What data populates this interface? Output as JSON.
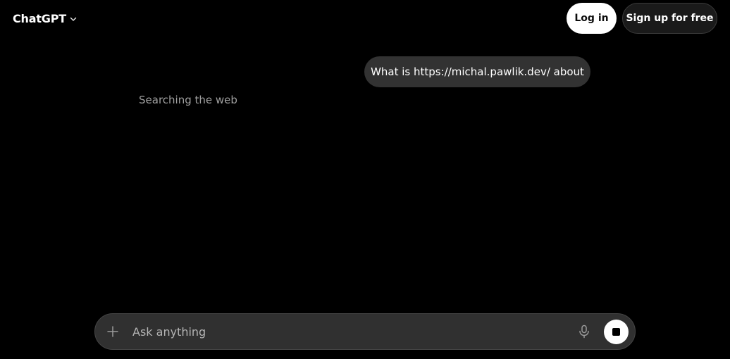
{
  "header": {
    "model_name": "ChatGPT",
    "model_switcher_icon": "chevron-down-icon",
    "login_label": "Log in",
    "signup_label": "Sign up for free"
  },
  "conversation": {
    "user_message": "What is https://michal.pawlik.dev/ about",
    "assistant_status": "Searching the web"
  },
  "composer": {
    "placeholder": "Ask anything",
    "value": "",
    "attach_icon": "plus-icon",
    "voice_icon": "microphone-icon",
    "stop_icon": "stop-icon"
  },
  "colors": {
    "background": "#000000",
    "user_bubble": "#323232",
    "composer_bg": "#303030",
    "primary_button": "#ffffff",
    "muted_text": "#a0a0a0"
  }
}
